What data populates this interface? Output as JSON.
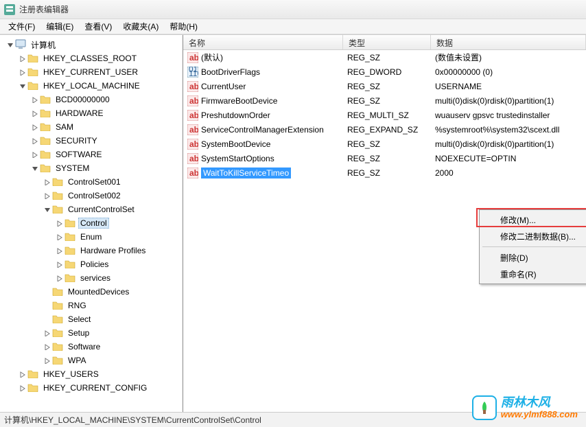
{
  "window": {
    "title": "注册表编辑器"
  },
  "menu": {
    "file": "文件(F)",
    "edit": "编辑(E)",
    "view": "查看(V)",
    "fav": "收藏夹(A)",
    "help": "帮助(H)"
  },
  "tree": {
    "root": "计算机",
    "hkcr": "HKEY_CLASSES_ROOT",
    "hkcu": "HKEY_CURRENT_USER",
    "hklm": "HKEY_LOCAL_MACHINE",
    "bcd": "BCD00000000",
    "hardware": "HARDWARE",
    "sam": "SAM",
    "security": "SECURITY",
    "software": "SOFTWARE",
    "system": "SYSTEM",
    "cs001": "ControlSet001",
    "cs002": "ControlSet002",
    "ccs": "CurrentControlSet",
    "control": "Control",
    "enum": "Enum",
    "hwprofiles": "Hardware Profiles",
    "policies": "Policies",
    "services": "services",
    "mounted": "MountedDevices",
    "rng": "RNG",
    "select": "Select",
    "setup": "Setup",
    "software2": "Software",
    "wpa": "WPA",
    "hku": "HKEY_USERS",
    "hkcc": "HKEY_CURRENT_CONFIG"
  },
  "columns": {
    "name": "名称",
    "type": "类型",
    "data": "数据"
  },
  "values": [
    {
      "name": "(默认)",
      "kind": "str",
      "type": "REG_SZ",
      "data": "(数值未设置)"
    },
    {
      "name": "BootDriverFlags",
      "kind": "bin",
      "type": "REG_DWORD",
      "data": "0x00000000 (0)"
    },
    {
      "name": "CurrentUser",
      "kind": "str",
      "type": "REG_SZ",
      "data": "USERNAME"
    },
    {
      "name": "FirmwareBootDevice",
      "kind": "str",
      "type": "REG_SZ",
      "data": "multi(0)disk(0)rdisk(0)partition(1)"
    },
    {
      "name": "PreshutdownOrder",
      "kind": "str",
      "type": "REG_MULTI_SZ",
      "data": "wuauserv gpsvc trustedinstaller"
    },
    {
      "name": "ServiceControlManagerExtension",
      "kind": "str",
      "type": "REG_EXPAND_SZ",
      "data": "%systemroot%\\system32\\scext.dll"
    },
    {
      "name": "SystemBootDevice",
      "kind": "str",
      "type": "REG_SZ",
      "data": "multi(0)disk(0)rdisk(0)partition(1)"
    },
    {
      "name": "SystemStartOptions",
      "kind": "str",
      "type": "REG_SZ",
      "data": " NOEXECUTE=OPTIN"
    },
    {
      "name": "WaitToKillServiceTimeo",
      "kind": "str",
      "type": "REG_SZ",
      "data": "2000",
      "selected": true
    }
  ],
  "context": {
    "modify": "修改(M)...",
    "modify_bin": "修改二进制数据(B)...",
    "delete": "删除(D)",
    "rename": "重命名(R)"
  },
  "statusbar": {
    "path": "计算机\\HKEY_LOCAL_MACHINE\\SYSTEM\\CurrentControlSet\\Control"
  },
  "watermark": {
    "cn": "雨林木风",
    "url": "www.ylmf888.com"
  }
}
